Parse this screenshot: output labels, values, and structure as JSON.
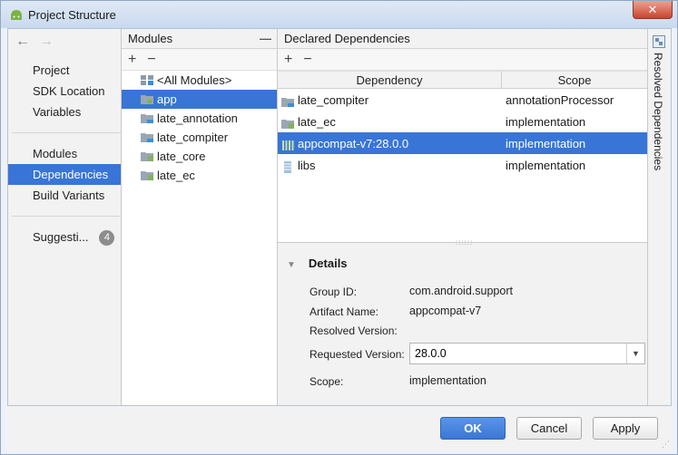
{
  "window": {
    "title": "Project Structure",
    "close_label": "✕"
  },
  "nav": {
    "group1": [
      "Project",
      "SDK Location",
      "Variables"
    ],
    "group2": [
      "Modules",
      "Dependencies",
      "Build Variants"
    ],
    "suggestions_label": "Suggesti...",
    "suggestions_count": "4",
    "selected": "Dependencies"
  },
  "modules": {
    "header": "Modules",
    "add_label": "+",
    "remove_label": "−",
    "items": [
      "<All Modules>",
      "app",
      "late_annotation",
      "late_compiter",
      "late_core",
      "late_ec"
    ],
    "selected": "app"
  },
  "dependencies": {
    "header": "Declared Dependencies",
    "add_label": "+",
    "remove_label": "−",
    "columns": [
      "Dependency",
      "Scope"
    ],
    "rows": [
      {
        "name": "late_compiter",
        "scope": "annotationProcessor",
        "icon": "module-folder-icon"
      },
      {
        "name": "late_ec",
        "scope": "implementation",
        "icon": "library-folder-icon"
      },
      {
        "name": "appcompat-v7:28.0.0",
        "scope": "implementation",
        "icon": "library-icon"
      },
      {
        "name": "libs",
        "scope": "implementation",
        "icon": "library-icon"
      }
    ],
    "selected_index": 2
  },
  "details": {
    "title": "Details",
    "group_id_label": "Group ID:",
    "group_id": "com.android.support",
    "artifact_label": "Artifact Name:",
    "artifact": "appcompat-v7",
    "resolved_label": "Resolved Version:",
    "resolved": "",
    "requested_label": "Requested Version:",
    "requested": "28.0.0",
    "scope_label": "Scope:",
    "scope": "implementation"
  },
  "right_strip": {
    "label": "Resolved Dependencies"
  },
  "footer": {
    "ok": "OK",
    "cancel": "Cancel",
    "apply": "Apply"
  },
  "colors": {
    "selection": "#3875d7",
    "panel": "#f2f2f2",
    "badge": "#8d8d8d"
  }
}
